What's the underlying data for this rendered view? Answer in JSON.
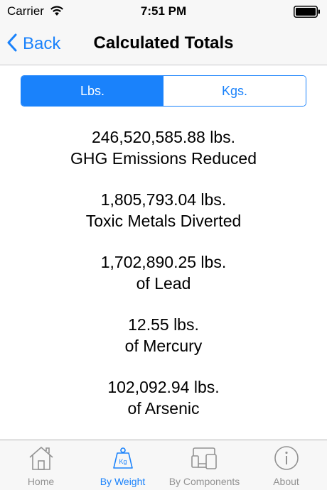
{
  "status_bar": {
    "carrier": "Carrier",
    "time": "7:51 PM"
  },
  "navbar": {
    "back_label": "Back",
    "title": "Calculated Totals"
  },
  "segmented_control": {
    "options": [
      "Lbs.",
      "Kgs."
    ],
    "selected": "Lbs."
  },
  "totals": [
    {
      "value": "246,520,585.88 lbs.",
      "label": "GHG Emissions Reduced"
    },
    {
      "value": "1,805,793.04 lbs.",
      "label": "Toxic Metals Diverted"
    },
    {
      "value": "1,702,890.25 lbs.",
      "label": "of Lead"
    },
    {
      "value": "12.55 lbs.",
      "label": "of Mercury"
    },
    {
      "value": "102,092.94 lbs.",
      "label": "of Arsenic"
    }
  ],
  "tab_bar": {
    "tabs": [
      {
        "label": "Home",
        "icon": "house-icon",
        "active": false
      },
      {
        "label": "By Weight",
        "icon": "weight-icon",
        "active": true
      },
      {
        "label": "By Components",
        "icon": "devices-icon",
        "active": false
      },
      {
        "label": "About",
        "icon": "info-icon",
        "active": false
      }
    ],
    "weight_icon_text": "Kg"
  },
  "colors": {
    "accent": "#1a82fb",
    "inactive": "#929292",
    "bar_background": "#f7f7f7"
  }
}
